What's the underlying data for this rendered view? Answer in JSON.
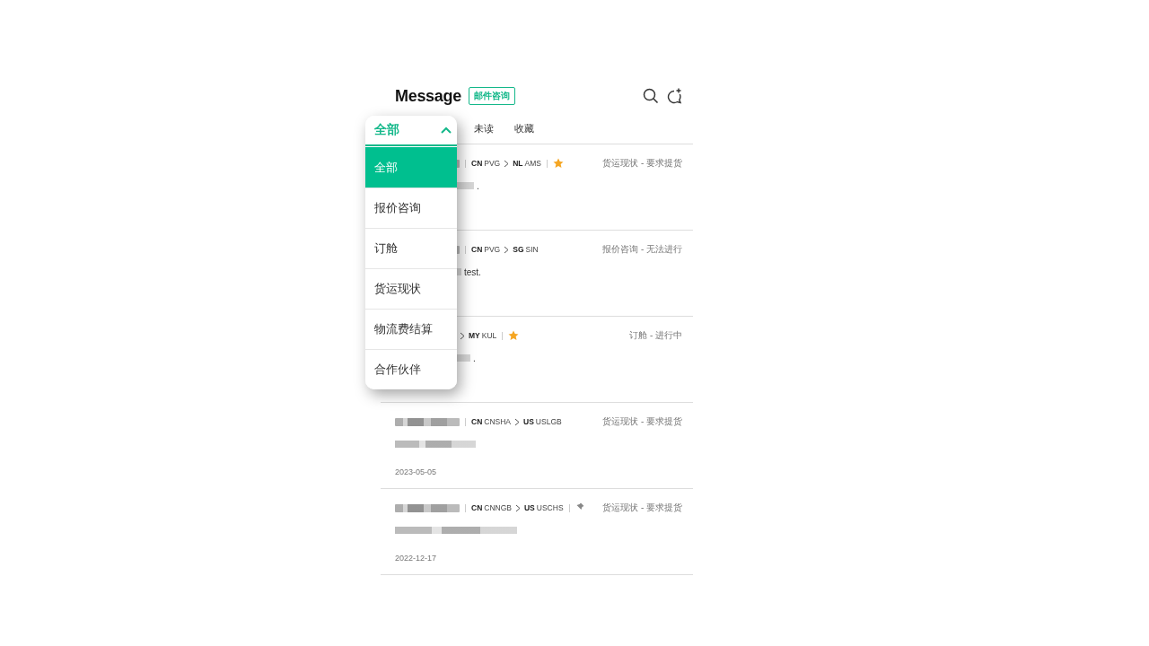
{
  "header": {
    "title": "Message",
    "badge": "邮件咨询"
  },
  "tabs": [
    {
      "label": "未读",
      "selected": false
    },
    {
      "label": "收藏",
      "selected": false
    }
  ],
  "filter": {
    "current": "全部",
    "expanded": true,
    "options": [
      {
        "label": "全部",
        "selected": true
      },
      {
        "label": "报价咨询",
        "selected": false
      },
      {
        "label": "订舱",
        "selected": false
      },
      {
        "label": "货运现状",
        "selected": false
      },
      {
        "label": "物流费结算",
        "selected": false
      },
      {
        "label": "合作伙伴",
        "selected": false
      }
    ]
  },
  "messages": [
    {
      "from_country": "CN",
      "from_port": "PVG",
      "to_country": "NL",
      "to_port": "AMS",
      "starred": true,
      "pinned": false,
      "status": "货运现状 - 要求提货",
      "preview": "."
    },
    {
      "from_country": "CN",
      "from_port": "PVG",
      "to_country": "SG",
      "to_port": "SIN",
      "starred": false,
      "pinned": false,
      "status": "报价咨询 - 无法进行",
      "preview": "test."
    },
    {
      "to_country": "MY",
      "to_port": "KUL",
      "starred": true,
      "pinned": false,
      "status": "订舱 - 进行中",
      "preview": "."
    },
    {
      "from_country": "CN",
      "from_port": "CNSHA",
      "to_country": "US",
      "to_port": "USLGB",
      "starred": false,
      "pinned": false,
      "status": "货运现状 - 要求提货",
      "date": "2023-05-05"
    },
    {
      "from_country": "CN",
      "from_port": "CNNGB",
      "to_country": "US",
      "to_port": "USCHS",
      "starred": false,
      "pinned": true,
      "status": "货运现状 - 要求提货",
      "date": "2022-12-17"
    }
  ]
}
